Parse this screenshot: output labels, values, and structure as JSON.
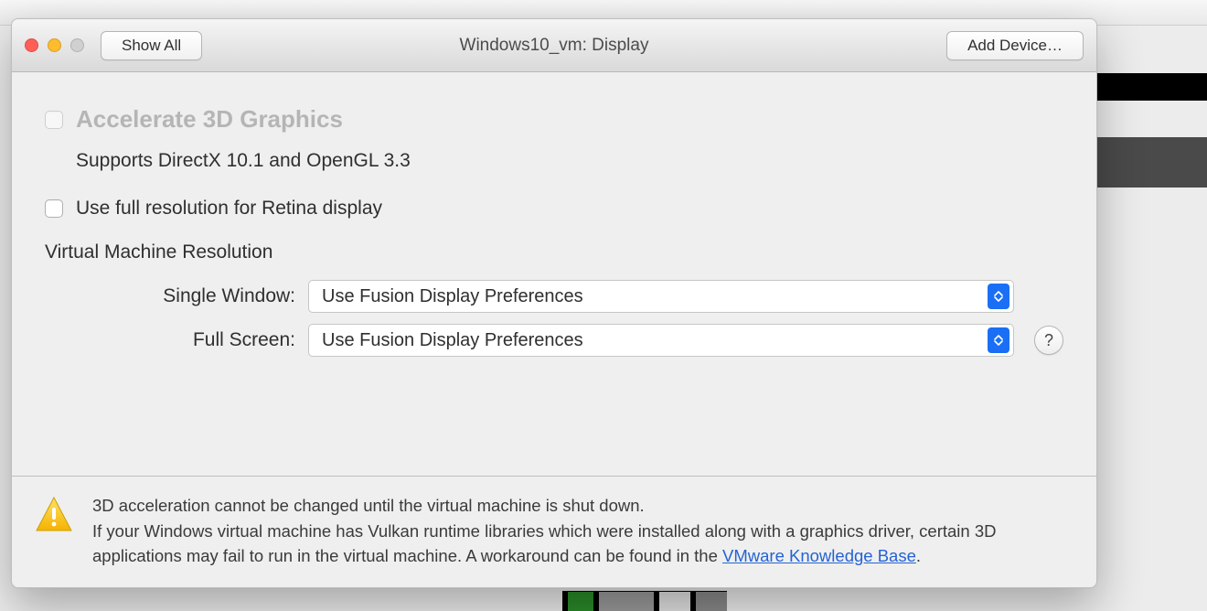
{
  "titlebar": {
    "show_all_label": "Show All",
    "window_title": "Windows10_vm: Display",
    "add_device_label": "Add Device…"
  },
  "accel3d": {
    "label": "Accelerate 3D Graphics",
    "support_text": "Supports DirectX 10.1 and OpenGL 3.3"
  },
  "retina": {
    "label": "Use full resolution for Retina display"
  },
  "vmres": {
    "heading": "Virtual Machine Resolution",
    "single_window_label": "Single Window:",
    "single_window_value": "Use Fusion Display Preferences",
    "full_screen_label": "Full Screen:",
    "full_screen_value": "Use Fusion Display Preferences"
  },
  "help": {
    "symbol": "?"
  },
  "footer": {
    "line1": "3D acceleration cannot be changed until the virtual machine is shut down.",
    "line2a": "If your Windows virtual machine has Vulkan runtime libraries which were installed along with a graphics driver, certain 3D applications may fail to run in the virtual machine. A workaround can be found in the ",
    "kb_link_text": "VMware Knowledge Base",
    "line2b": "."
  }
}
